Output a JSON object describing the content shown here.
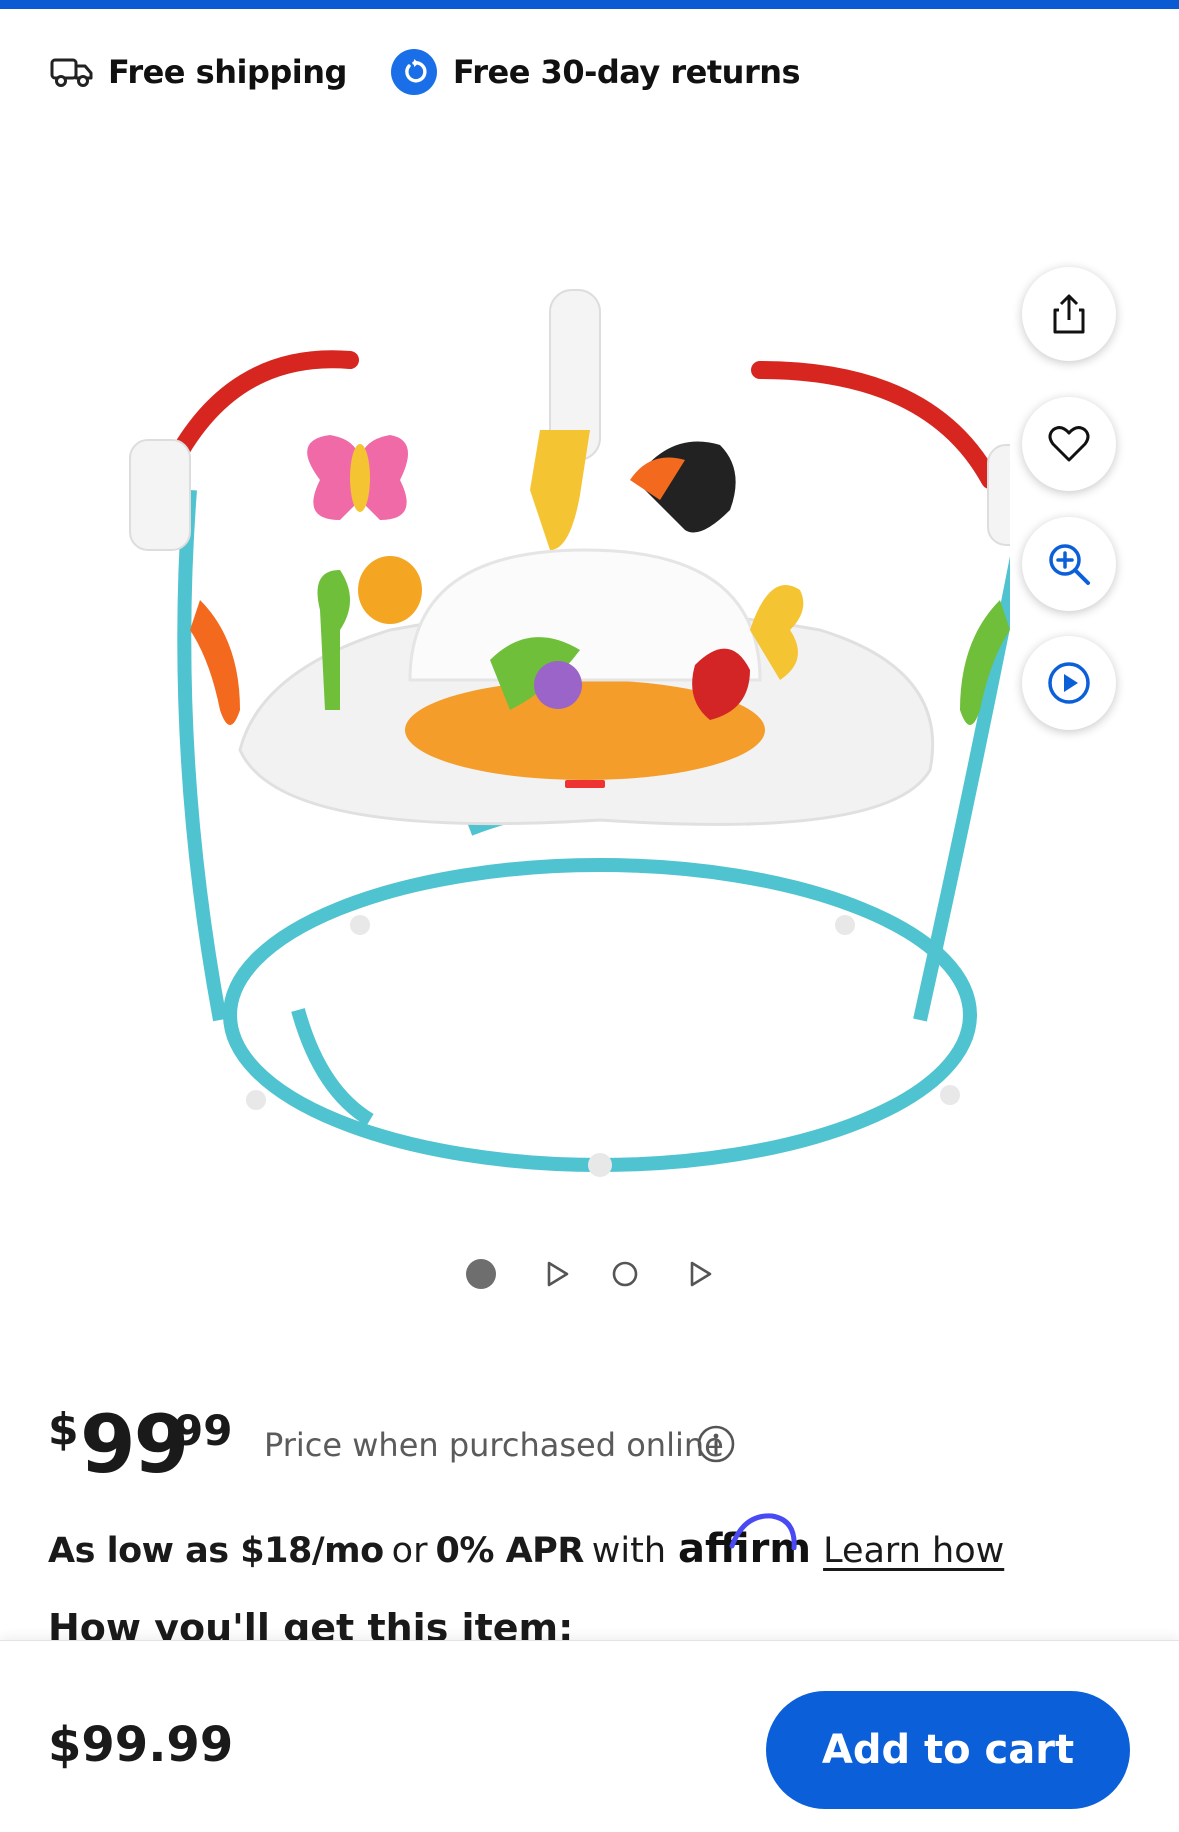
{
  "benefits": {
    "shipping_label": "Free shipping",
    "returns_label": "Free 30-day returns"
  },
  "gallery": {
    "image_alt": "Baby activity jumper with jungle animal toys",
    "actions": [
      {
        "name": "share-icon"
      },
      {
        "name": "heart-icon"
      },
      {
        "name": "zoom-in-icon"
      },
      {
        "name": "play-icon"
      }
    ],
    "carousel_indicators": [
      {
        "kind": "image",
        "active": true
      },
      {
        "kind": "video",
        "active": false
      },
      {
        "kind": "image",
        "active": false
      },
      {
        "kind": "video",
        "active": false
      }
    ]
  },
  "price": {
    "currency": "$",
    "dollars": "99",
    "cents": "99",
    "note": "Price when purchased online"
  },
  "financing": {
    "as_low_as": "As low as $18/mo",
    "or": "or",
    "apr": "0% APR",
    "with": "with",
    "provider": "affirm",
    "link": "Learn how"
  },
  "fulfillment": {
    "heading": "How you'll get this item:"
  },
  "bottom_bar": {
    "price": "$99.99",
    "add_to_cart": "Add to cart"
  },
  "colors": {
    "brand_blue": "#0b5fd9",
    "top_bar": "#0a5bd3"
  }
}
